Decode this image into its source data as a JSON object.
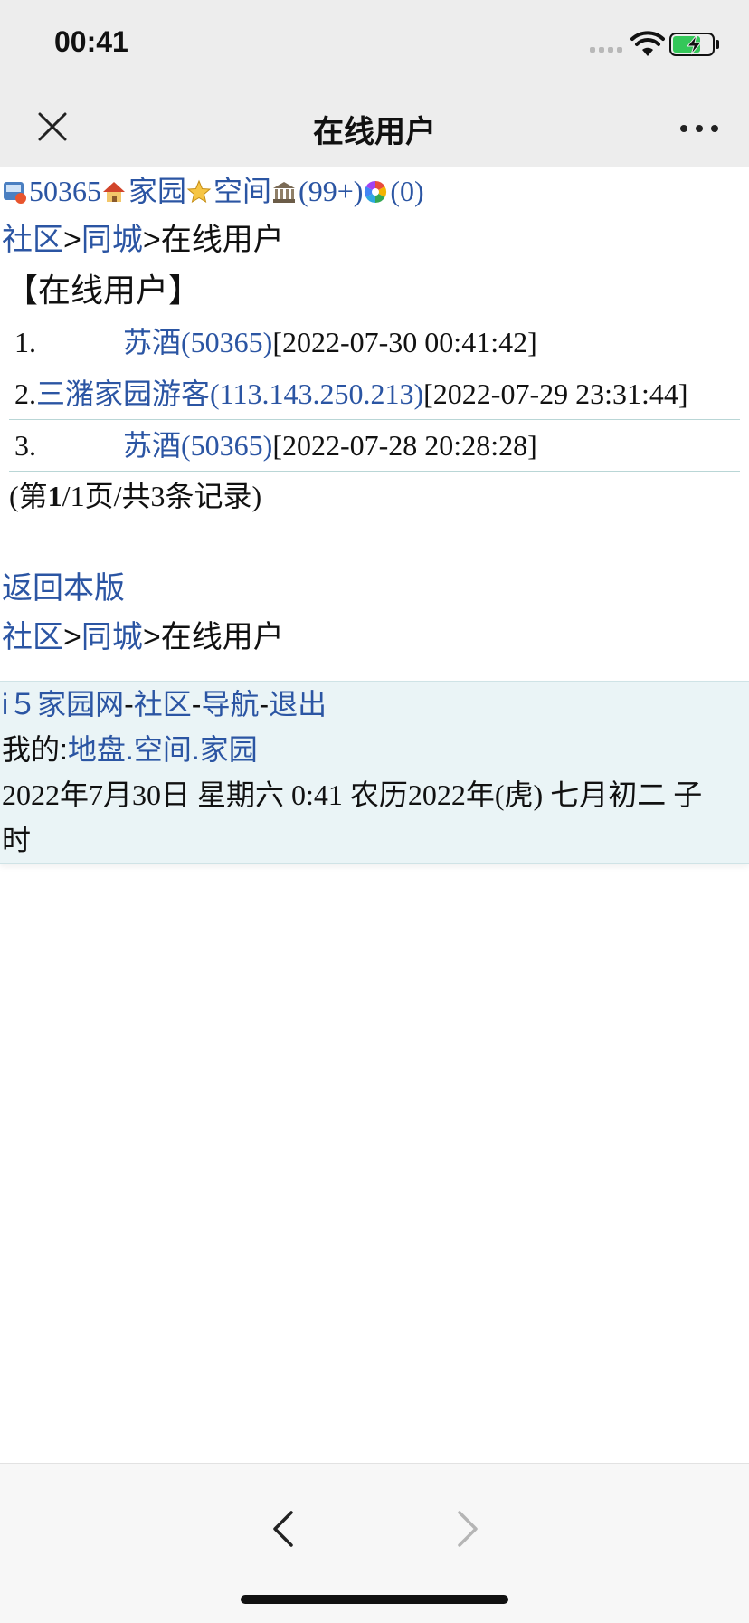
{
  "status_bar": {
    "time": "00:41"
  },
  "nav": {
    "title": "在线用户"
  },
  "top_links": {
    "user_id": "50365",
    "home_label": "家园",
    "space_label": "空间",
    "messages_count": "(99+)",
    "other_count": "(0)"
  },
  "breadcrumb": {
    "community": "社区",
    "city": "同城",
    "current": "在线用户",
    "separator": ">"
  },
  "section_title": "【在线用户】",
  "online_users": [
    {
      "index": "1.",
      "name": "苏酒(50365)",
      "time": "[2022-07-30 00:41:42]"
    },
    {
      "index": "2.",
      "name": "三潴家园游客(113.143.250.213)",
      "time": "[2022-07-29 23:31:44]"
    },
    {
      "index": "3.",
      "name": "苏酒(50365)",
      "time": "[2022-07-28 20:28:28]"
    }
  ],
  "pager": {
    "prefix": "(第",
    "page": "1",
    "suffix": "/1页/共3条记录)"
  },
  "back_to_board": "返回本版",
  "footer": {
    "site": "i５家园网",
    "community": "社区",
    "navigation": "导航",
    "logout": "退出",
    "dash": "-",
    "mine_label": "我的:",
    "land": "地盘",
    "space": "空间",
    "home": "家园",
    "dot": ".",
    "datetime": "2022年7月30日  星期六  0:41  农历2022年(虎)  七月初二  子时"
  },
  "colors": {
    "link": "#2b55a3",
    "footer_bg": "#eaf4f6",
    "bar_bg": "#ededed"
  }
}
